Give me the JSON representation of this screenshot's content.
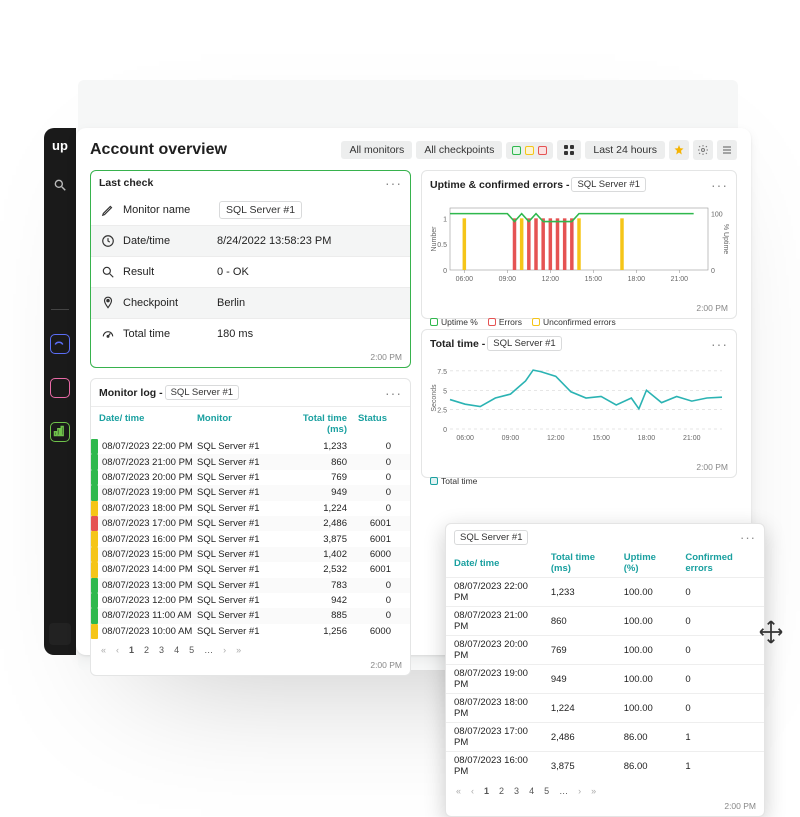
{
  "colors": {
    "green": "#2fb84d",
    "yellow": "#f5c518",
    "red": "#e55353",
    "teal": "#1aa0a0",
    "border": "#e4e5e5"
  },
  "header": {
    "title": "Account overview",
    "monitors": "All monitors",
    "checkpoints": "All checkpoints",
    "range": "Last 24 hours"
  },
  "sidebar": {
    "brand": "up"
  },
  "last_check": {
    "title": "Last check",
    "timestamp": "2:00 PM",
    "rows": [
      {
        "icon": "pencil",
        "label": "Monitor name",
        "value": "SQL Server #1",
        "tag": true
      },
      {
        "icon": "clock",
        "label": "Date/time",
        "value": "8/24/2022 13:58:23 PM"
      },
      {
        "icon": "search",
        "label": "Result",
        "value": "0 - OK"
      },
      {
        "icon": "pin",
        "label": "Checkpoint",
        "value": "Berlin"
      },
      {
        "icon": "gauge",
        "label": "Total time",
        "value": "180 ms"
      }
    ]
  },
  "monitor_log": {
    "title_prefix": "Monitor log - ",
    "tag": "SQL Server #1",
    "timestamp": "2:00 PM",
    "columns": [
      "Date/ time",
      "Monitor",
      "Total time (ms)",
      "Status"
    ],
    "rows": [
      {
        "c": "g",
        "dt": "08/07/2023 22:00 PM",
        "mon": "SQL Server #1",
        "tt": "1,233",
        "st": "0"
      },
      {
        "c": "g",
        "dt": "08/07/2023 21:00 PM",
        "mon": "SQL Server #1",
        "tt": "860",
        "st": "0"
      },
      {
        "c": "g",
        "dt": "08/07/2023 20:00 PM",
        "mon": "SQL Server #1",
        "tt": "769",
        "st": "0"
      },
      {
        "c": "g",
        "dt": "08/07/2023 19:00 PM",
        "mon": "SQL Server #1",
        "tt": "949",
        "st": "0"
      },
      {
        "c": "y",
        "dt": "08/07/2023 18:00 PM",
        "mon": "SQL Server #1",
        "tt": "1,224",
        "st": "0"
      },
      {
        "c": "r",
        "dt": "08/07/2023 17:00 PM",
        "mon": "SQL Server #1",
        "tt": "2,486",
        "st": "6001"
      },
      {
        "c": "y",
        "dt": "08/07/2023 16:00 PM",
        "mon": "SQL Server #1",
        "tt": "3,875",
        "st": "6001"
      },
      {
        "c": "y",
        "dt": "08/07/2023 15:00 PM",
        "mon": "SQL Server #1",
        "tt": "1,402",
        "st": "6000"
      },
      {
        "c": "y",
        "dt": "08/07/2023 14:00 PM",
        "mon": "SQL Server #1",
        "tt": "2,532",
        "st": "6001"
      },
      {
        "c": "g",
        "dt": "08/07/2023 13:00 PM",
        "mon": "SQL Server #1",
        "tt": "783",
        "st": "0"
      },
      {
        "c": "g",
        "dt": "08/07/2023 12:00 PM",
        "mon": "SQL Server #1",
        "tt": "942",
        "st": "0"
      },
      {
        "c": "g",
        "dt": "08/07/2023 11:00 AM",
        "mon": "SQL Server #1",
        "tt": "885",
        "st": "0"
      },
      {
        "c": "y",
        "dt": "08/07/2023 10:00 AM",
        "mon": "SQL Server #1",
        "tt": "1,256",
        "st": "6000"
      }
    ],
    "pager": [
      "«",
      "‹",
      "1",
      "2",
      "3",
      "4",
      "5",
      "…",
      "›",
      "»"
    ],
    "active_page": "1"
  },
  "uptime_card": {
    "title_prefix": "Uptime & confirmed errors - ",
    "tag": "SQL Server #1",
    "timestamp": "2:00 PM",
    "legend": [
      {
        "label": "Uptime %",
        "color": "#2fb84d"
      },
      {
        "label": "Errors",
        "color": "#e55353"
      },
      {
        "label": "Unconfirmed errors",
        "color": "#f5c518"
      }
    ],
    "ylabel_left": "Number",
    "ylabel_right": "% Uptime"
  },
  "total_time_card": {
    "title_prefix": "Total time - ",
    "tag": "SQL Server #1",
    "timestamp": "2:00 PM",
    "legend": [
      {
        "label": "Total time",
        "color": "#1aa0a0"
      }
    ],
    "ylabel": "Seconds"
  },
  "popup": {
    "tag": "SQL Server #1",
    "timestamp": "2:00 PM",
    "columns": [
      "Date/ time",
      "Total time (ms)",
      "Uptime (%)",
      "Confirmed errors"
    ],
    "rows": [
      {
        "dt": "08/07/2023 22:00 PM",
        "tt": "1,233",
        "up": "100.00",
        "ce": "0"
      },
      {
        "dt": "08/07/2023 21:00 PM",
        "tt": "860",
        "up": "100.00",
        "ce": "0"
      },
      {
        "dt": "08/07/2023 20:00 PM",
        "tt": "769",
        "up": "100.00",
        "ce": "0"
      },
      {
        "dt": "08/07/2023 19:00 PM",
        "tt": "949",
        "up": "100.00",
        "ce": "0"
      },
      {
        "dt": "08/07/2023 18:00 PM",
        "tt": "1,224",
        "up": "100.00",
        "ce": "0"
      },
      {
        "dt": "08/07/2023 17:00 PM",
        "tt": "2,486",
        "up": "86.00",
        "ce": "1"
      },
      {
        "dt": "08/07/2023 16:00 PM",
        "tt": "3,875",
        "up": "86.00",
        "ce": "1"
      }
    ],
    "pager": [
      "«",
      "‹",
      "1",
      "2",
      "3",
      "4",
      "5",
      "…",
      "›",
      "»"
    ]
  },
  "chart_data": [
    {
      "type": "line",
      "id": "uptime-confirmed-errors",
      "title": "Uptime & confirmed errors",
      "x_ticks": [
        "06:00",
        "09:00",
        "12:00",
        "15:00",
        "18:00",
        "21:00"
      ],
      "y_left": {
        "label": "Number",
        "ticks": [
          0,
          0.5,
          1
        ],
        "range": [
          0,
          1.2
        ]
      },
      "y_right": {
        "label": "% Uptime",
        "ticks": [
          0,
          100
        ],
        "range": [
          0,
          110
        ]
      },
      "series": [
        {
          "name": "Uptime %",
          "color": "#2fb84d",
          "axis": "right",
          "x": [
            "05:00",
            "06:00",
            "07:00",
            "08:00",
            "09:00",
            "09:30",
            "10:00",
            "10:30",
            "11:00",
            "11:30",
            "12:00",
            "12:30",
            "13:00",
            "13:30",
            "14:00",
            "15:00",
            "16:00",
            "17:00",
            "18:00",
            "19:00",
            "20:00",
            "21:00",
            "22:00"
          ],
          "y": [
            100,
            100,
            100,
            100,
            100,
            86,
            100,
            86,
            100,
            86,
            86,
            86,
            86,
            86,
            100,
            100,
            100,
            100,
            100,
            100,
            100,
            100,
            100
          ]
        }
      ],
      "bars": {
        "name": "Errors / Unconfirmed errors (stacked)",
        "x": [
          "06:00",
          "09:30",
          "10:00",
          "10:30",
          "11:00",
          "11:30",
          "12:00",
          "12:30",
          "13:00",
          "13:30",
          "14:00",
          "17:00"
        ],
        "errors": [
          0,
          1,
          0,
          1,
          1,
          1,
          1,
          1,
          1,
          1,
          0,
          0
        ],
        "unconfirmed": [
          1,
          0,
          1,
          0,
          0,
          0,
          0,
          0,
          0,
          0,
          1,
          1
        ],
        "colors": {
          "errors": "#e55353",
          "unconfirmed": "#f5c518"
        }
      }
    },
    {
      "type": "line",
      "id": "total-time",
      "title": "Total time",
      "x_ticks": [
        "06:00",
        "09:00",
        "12:00",
        "15:00",
        "18:00",
        "21:00"
      ],
      "ylabel": "Seconds",
      "y_ticks": [
        0,
        2.5,
        5,
        7.5
      ],
      "ylim": [
        0,
        8
      ],
      "series": [
        {
          "name": "Total time",
          "color": "#2bb3b3",
          "x": [
            "05:00",
            "06:00",
            "07:00",
            "08:00",
            "09:00",
            "10:00",
            "10:30",
            "11:00",
            "12:00",
            "13:00",
            "14:00",
            "15:00",
            "16:00",
            "17:00",
            "17:30",
            "18:00",
            "19:00",
            "20:00",
            "21:00",
            "22:00",
            "23:00"
          ],
          "y": [
            3.8,
            3.2,
            2.9,
            4.0,
            4.5,
            6.2,
            7.6,
            7.4,
            6.8,
            4.8,
            4.0,
            4.2,
            3.1,
            4.0,
            2.6,
            5.0,
            3.4,
            4.2,
            3.6,
            4.0,
            4.1
          ]
        }
      ]
    }
  ]
}
